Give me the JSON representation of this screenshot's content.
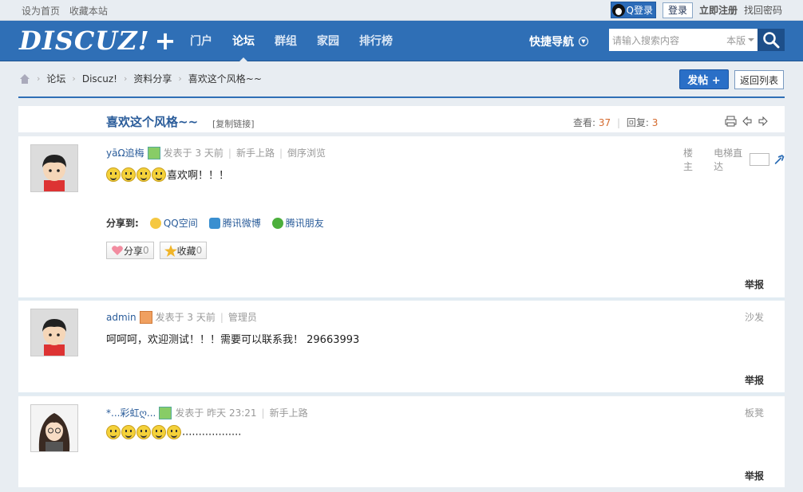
{
  "topbar": {
    "set_home": "设为首页",
    "bookmark": "收藏本站",
    "qq_login": "Q登录",
    "login": "登录",
    "register": "立即注册",
    "recover": "找回密码"
  },
  "nav": {
    "logo": "DISCUZ!",
    "logo_plus": "+",
    "items": [
      "门户",
      "论坛",
      "群组",
      "家园",
      "排行榜"
    ],
    "quick_nav": "快捷导航",
    "search_placeholder": "请输入搜索内容",
    "search_scope": "本版"
  },
  "breadcrumb": [
    "论坛",
    "Discuz!",
    "资料分享",
    "喜欢这个风格~~"
  ],
  "buttons": {
    "post": "发帖 +",
    "back": "返回列表"
  },
  "thread": {
    "title": "喜欢这个风格~~",
    "copy_link": "[复制链接]",
    "views_label": "查看:",
    "views": "37",
    "replies_label": "回复:",
    "replies": "3"
  },
  "posts": [
    {
      "author": "yāΩ追梅",
      "posted": "发表于 3 天前",
      "group": "新手上路",
      "order": "倒序浏览",
      "floor": "楼主",
      "jump": "电梯直达",
      "content": "喜欢啊！！！",
      "smiles": 4,
      "share_label": "分享到:",
      "share_targets": [
        "QQ空间",
        "腾讯微博",
        "腾讯朋友"
      ],
      "share_btn": "分享",
      "share_count": "0",
      "fav_btn": "收藏",
      "fav_count": "0",
      "report": "举报"
    },
    {
      "author": "admin",
      "posted": "发表于 3 天前",
      "group": "管理员",
      "floor": "沙发",
      "content": "呵呵呵，欢迎测试！！！需要可以联系我！ 29663993",
      "report": "举报"
    },
    {
      "author": "*...彩虹ღ...",
      "posted": "发表于 昨天 23:21",
      "group": "新手上路",
      "floor": "板凳",
      "content": "..................",
      "smiles": 5,
      "report": "举报"
    }
  ],
  "colors": {
    "nav_blue": "#2f6fb6",
    "title_blue": "#2a5c9a",
    "accent_orange": "#d46a2e"
  }
}
